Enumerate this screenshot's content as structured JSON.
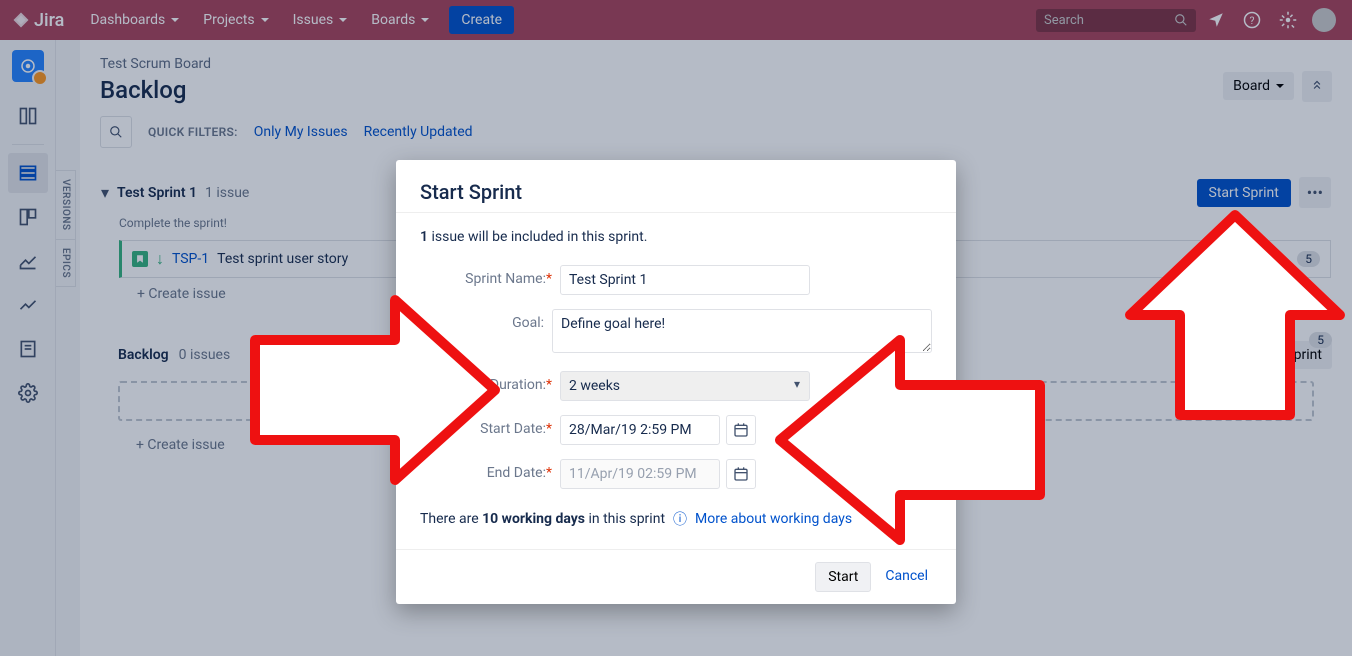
{
  "topnav": {
    "logo": "Jira",
    "items": [
      "Dashboards",
      "Projects",
      "Issues",
      "Boards"
    ],
    "create": "Create",
    "search_placeholder": "Search"
  },
  "vtabs": [
    "VERSIONS",
    "EPICS"
  ],
  "page": {
    "breadcrumb": "Test Scrum Board",
    "title": "Backlog",
    "board_btn": "Board",
    "filters_label": "QUICK FILTERS:",
    "filter_only_my": "Only My Issues",
    "filter_recent": "Recently Updated"
  },
  "sprint": {
    "name": "Test Sprint 1",
    "count": "1 issue",
    "subtitle": "Complete the sprint!",
    "start_btn": "Start Sprint",
    "issue": {
      "key": "TSP-1",
      "summary": "Test sprint user story",
      "points": "5"
    },
    "create_issue": "+  Create issue"
  },
  "backlog": {
    "name": "Backlog",
    "count": "0 issues",
    "create_sprint": "Create sprint",
    "points": "5",
    "create_issue": "+  Create issue"
  },
  "modal": {
    "title": "Start Sprint",
    "info_count": "1",
    "info_text": " issue will be included in this sprint.",
    "labels": {
      "sprint_name": "Sprint Name:",
      "goal": "Goal:",
      "duration": "Duration:",
      "start_date": "Start Date:",
      "end_date": "End Date:"
    },
    "values": {
      "sprint_name": "Test Sprint 1",
      "goal": "Define goal here!",
      "duration": "2 weeks",
      "start_date": "28/Mar/19 2:59 PM",
      "end_date": "11/Apr/19 02:59 PM"
    },
    "working_days_prefix": "There are ",
    "working_days_bold": "10 working days",
    "working_days_suffix": " in this sprint",
    "more_link": "More about working days",
    "start": "Start",
    "cancel": "Cancel"
  }
}
